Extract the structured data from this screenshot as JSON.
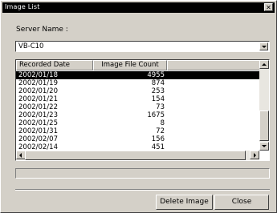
{
  "window": {
    "title": "Image List"
  },
  "server": {
    "label": "Server Name :",
    "value": "VB-C10"
  },
  "table": {
    "columns": [
      "Recorded Date",
      "Image File Count",
      ""
    ],
    "rows": [
      {
        "date": "2002/01/18",
        "count": "4955"
      },
      {
        "date": "2002/01/19",
        "count": "874"
      },
      {
        "date": "2002/01/20",
        "count": "253"
      },
      {
        "date": "2002/01/21",
        "count": "154"
      },
      {
        "date": "2002/01/22",
        "count": "73"
      },
      {
        "date": "2002/01/23",
        "count": "1675"
      },
      {
        "date": "2002/01/25",
        "count": "8"
      },
      {
        "date": "2002/01/31",
        "count": "72"
      },
      {
        "date": "2002/02/07",
        "count": "156"
      },
      {
        "date": "2002/02/14",
        "count": "451"
      }
    ],
    "selected_row": 0
  },
  "buttons": {
    "delete": "Delete Image",
    "close": "Close"
  },
  "icons": {
    "close": "close-icon",
    "dropdown": "chevron-down-icon"
  }
}
